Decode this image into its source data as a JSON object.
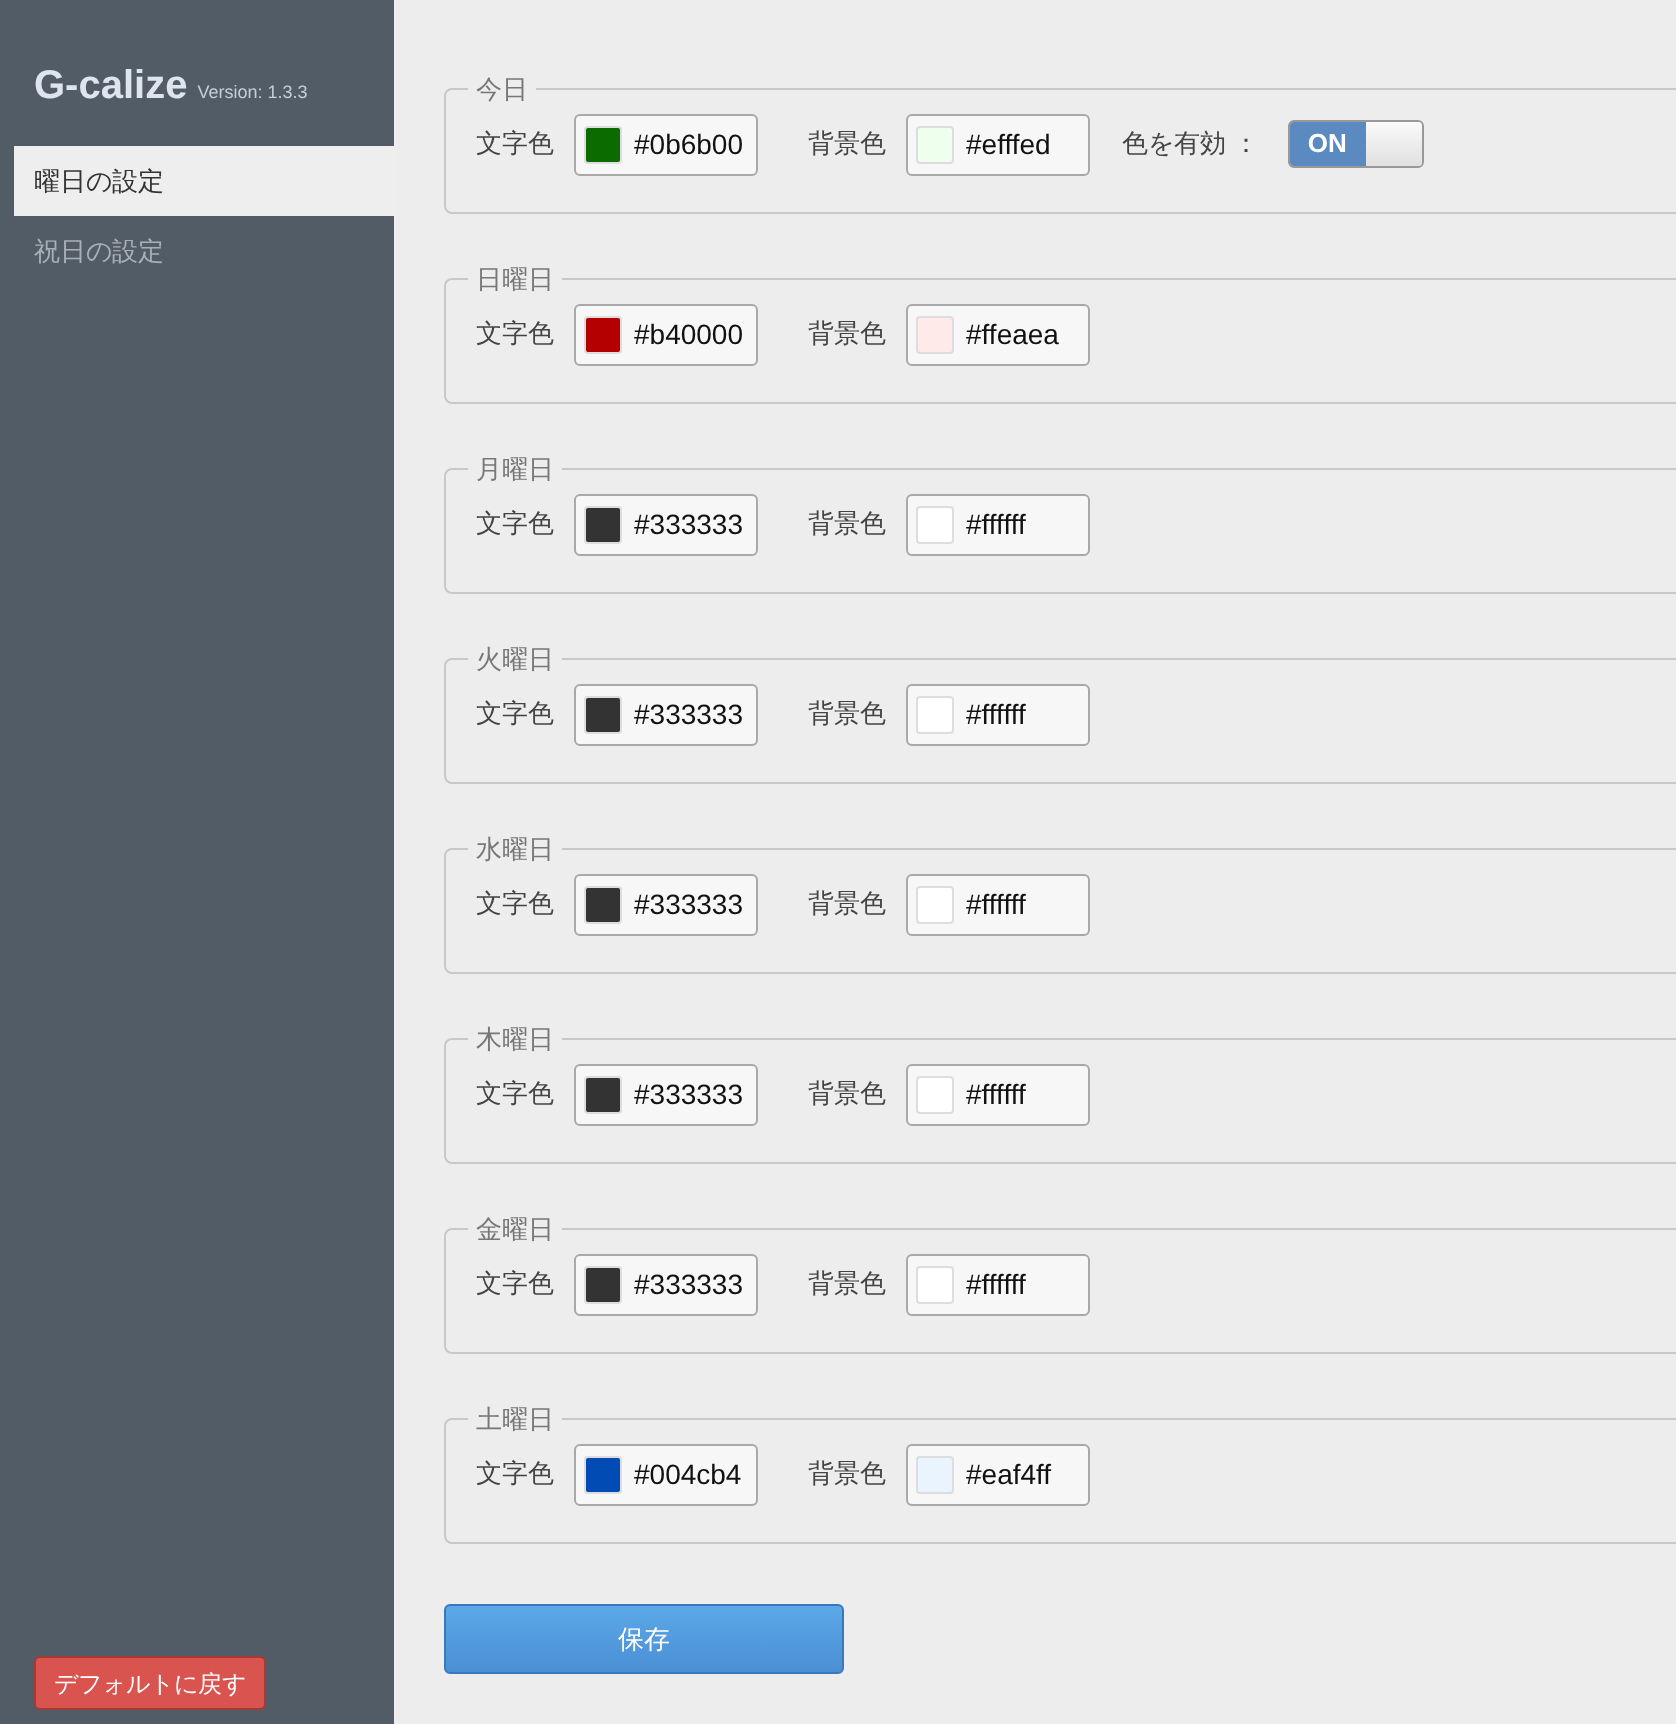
{
  "app": {
    "title": "G-calize",
    "version": "Version: 1.3.3"
  },
  "nav": [
    {
      "label": "曜日の設定",
      "selected": true
    },
    {
      "label": "祝日の設定",
      "selected": false
    }
  ],
  "reset_button": "デフォルトに戻す",
  "sections": [
    {
      "legend": "今日",
      "text_label": "文字色",
      "text_color": {
        "value": "#0b6b00",
        "color": "#0b6b00"
      },
      "bg_label": "背景色",
      "bg_color": {
        "value": "#efffed",
        "color": "#efffed"
      },
      "toggle": {
        "label": "色を有効 ：",
        "text": "ON",
        "on": true
      }
    },
    {
      "legend": "日曜日",
      "text_label": "文字色",
      "text_color": {
        "value": "#b40000",
        "color": "#b40000"
      },
      "bg_label": "背景色",
      "bg_color": {
        "value": "#ffeaea",
        "color": "#ffeaea"
      }
    },
    {
      "legend": "月曜日",
      "text_label": "文字色",
      "text_color": {
        "value": "#333333",
        "color": "#333333"
      },
      "bg_label": "背景色",
      "bg_color": {
        "value": "#ffffff",
        "color": "#ffffff"
      }
    },
    {
      "legend": "火曜日",
      "text_label": "文字色",
      "text_color": {
        "value": "#333333",
        "color": "#333333"
      },
      "bg_label": "背景色",
      "bg_color": {
        "value": "#ffffff",
        "color": "#ffffff"
      }
    },
    {
      "legend": "水曜日",
      "text_label": "文字色",
      "text_color": {
        "value": "#333333",
        "color": "#333333"
      },
      "bg_label": "背景色",
      "bg_color": {
        "value": "#ffffff",
        "color": "#ffffff"
      }
    },
    {
      "legend": "木曜日",
      "text_label": "文字色",
      "text_color": {
        "value": "#333333",
        "color": "#333333"
      },
      "bg_label": "背景色",
      "bg_color": {
        "value": "#ffffff",
        "color": "#ffffff"
      }
    },
    {
      "legend": "金曜日",
      "text_label": "文字色",
      "text_color": {
        "value": "#333333",
        "color": "#333333"
      },
      "bg_label": "背景色",
      "bg_color": {
        "value": "#ffffff",
        "color": "#ffffff"
      }
    },
    {
      "legend": "土曜日",
      "text_label": "文字色",
      "text_color": {
        "value": "#004cb4",
        "color": "#004cb4"
      },
      "bg_label": "背景色",
      "bg_color": {
        "value": "#eaf4ff",
        "color": "#eaf4ff"
      }
    }
  ],
  "save_button": "保存"
}
